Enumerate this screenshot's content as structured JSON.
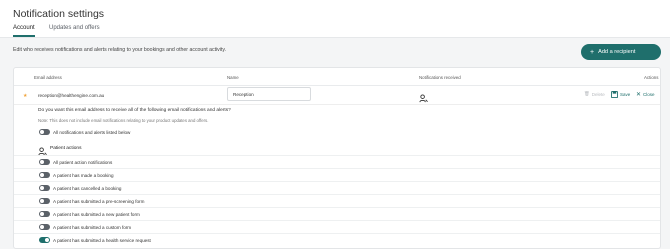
{
  "page": {
    "title": "Notification settings",
    "tabs": [
      {
        "label": "Account",
        "active": true
      },
      {
        "label": "Updates and offers",
        "active": false
      }
    ],
    "subtitle": "Edit who receives notifications and alerts relating to your bookings and other account activity.",
    "add_button_label": "Add a recipient"
  },
  "table": {
    "headers": {
      "email": "Email address",
      "name": "Name",
      "notifications": "Notifications received",
      "actions": "Actions"
    },
    "row": {
      "email": "reception@healthengine.com.au",
      "name": "Reception",
      "actions": {
        "delete": "Delete",
        "save": "Save",
        "close": "Close"
      }
    }
  },
  "preferences": {
    "question": "Do you want this email address to receive all of the following email notifications and alerts?",
    "note": "Note: This does not include email notifications relating to your product updates and offers.",
    "all_toggle": {
      "label": "All notifications and alerts listed below",
      "on": false
    },
    "section_title": "Patient actions",
    "items": [
      {
        "label": "All patient action notifications",
        "on": false
      },
      {
        "label": "A patient has made a booking",
        "on": false
      },
      {
        "label": "A patient has cancelled a booking",
        "on": false
      },
      {
        "label": "A patient has submitted a pre-screening form",
        "on": false
      },
      {
        "label": "A patient has submitted a new patient form",
        "on": false
      },
      {
        "label": "A patient has submitted a custom form",
        "on": false
      },
      {
        "label": "A patient has submitted a health service request",
        "on": true
      }
    ]
  },
  "colors": {
    "accent": "#1f6f6c",
    "star": "#f0a33a",
    "toggle_off": "#5b6168",
    "background": "#f4f5f6"
  }
}
